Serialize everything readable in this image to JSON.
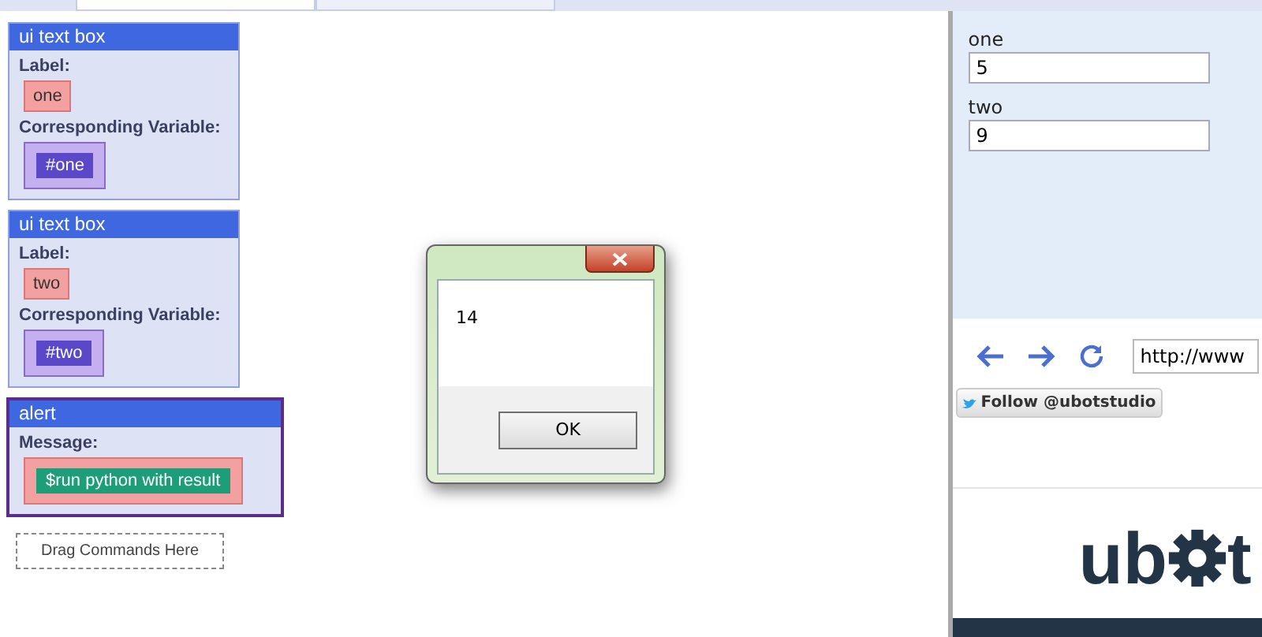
{
  "commands": [
    {
      "kind": "textbox",
      "title": "ui text box",
      "label_caption": "Label:",
      "label_value": "one",
      "variable_caption": "Corresponding Variable:",
      "variable_value": "#one",
      "selected": false
    },
    {
      "kind": "textbox",
      "title": "ui text box",
      "label_caption": "Label:",
      "label_value": "two",
      "variable_caption": "Corresponding Variable:",
      "variable_value": "#two",
      "selected": false
    },
    {
      "kind": "alert",
      "title": "alert",
      "message_caption": "Message:",
      "message_value": "$run python with result",
      "selected": true
    }
  ],
  "drop_zone": "Drag Commands Here",
  "dialog": {
    "message": "14",
    "button": "OK"
  },
  "ui_fields": [
    {
      "label": "one",
      "value": "5"
    },
    {
      "label": "two",
      "value": "9"
    }
  ],
  "browser": {
    "url": "http://www",
    "follow_button": "Follow @ubotstudio",
    "logo_start": "ub",
    "logo_end": "t"
  }
}
